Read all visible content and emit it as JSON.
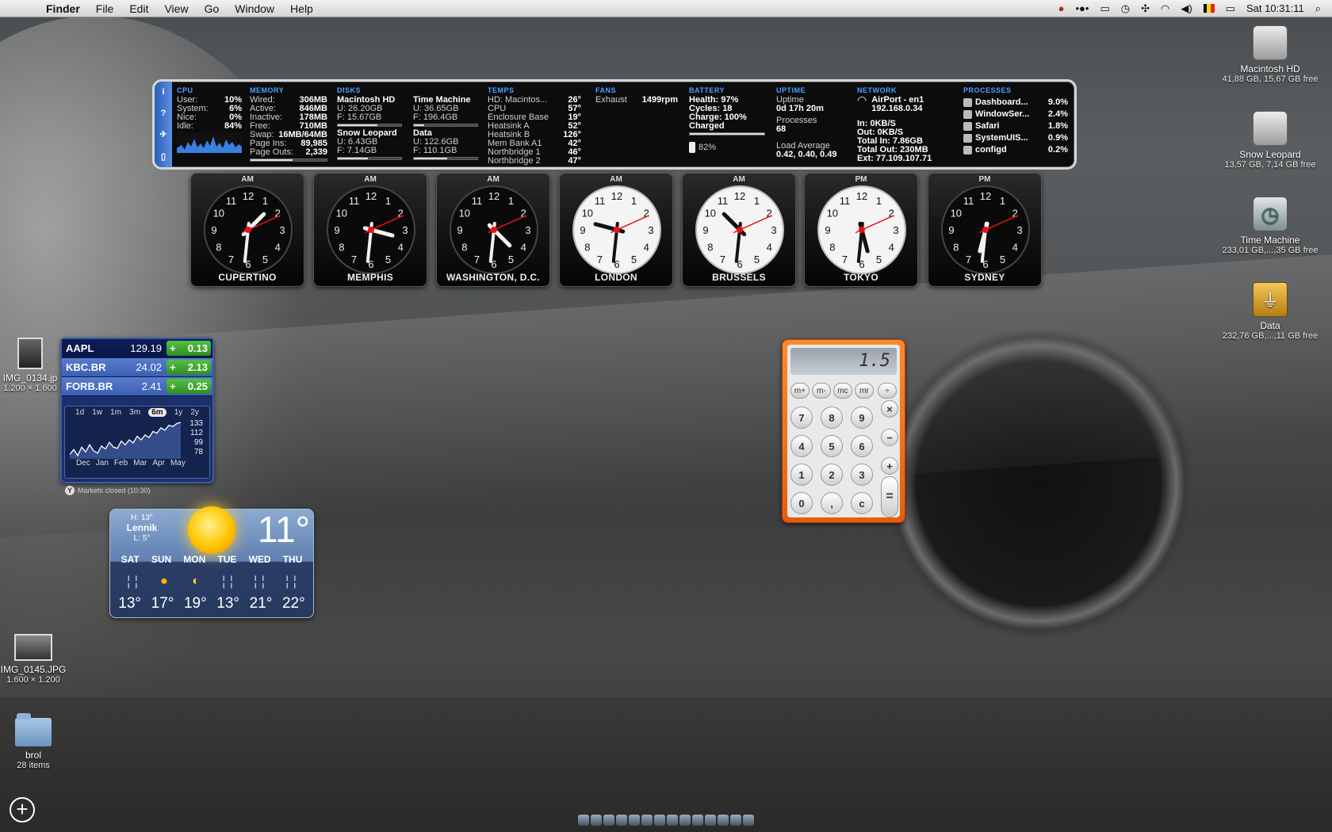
{
  "menubar": {
    "app": "Finder",
    "items": [
      "File",
      "Edit",
      "View",
      "Go",
      "Window",
      "Help"
    ],
    "clock": "Sat 10:31:11"
  },
  "desktop_icons": [
    {
      "name": "Macintosh HD",
      "sub": "41,88 GB, 15,67 GB free"
    },
    {
      "name": "Snow Leopard",
      "sub": "13,57 GB, 7,14 GB free"
    },
    {
      "name": "Time Machine",
      "sub": "233,01 GB,...,35 GB free"
    },
    {
      "name": "Data",
      "sub": "232,76 GB,...,11 GB free"
    }
  ],
  "left_icons": [
    {
      "name": "IMG_0134.jp",
      "sub": "1.200 × 1.600"
    },
    {
      "name": "IMG_0145.JPG",
      "sub": "1.600 × 1.200"
    },
    {
      "name": "brol",
      "sub": "28 items"
    }
  ],
  "istat": {
    "tabs": [
      "i",
      "?",
      "✈",
      "▯"
    ],
    "cpu": {
      "h": "CPU",
      "rows": [
        [
          "User:",
          "10%"
        ],
        [
          "System:",
          "6%"
        ],
        [
          "Nice:",
          "0%"
        ],
        [
          "Idle:",
          "84%"
        ]
      ]
    },
    "memory": {
      "h": "MEMORY",
      "rows": [
        [
          "Wired:",
          "306MB"
        ],
        [
          "Active:",
          "846MB"
        ],
        [
          "Inactive:",
          "178MB"
        ],
        [
          "Free:",
          "710MB"
        ],
        [
          "Swap:",
          "16MB/64MB"
        ],
        [
          "Page Ins:",
          "89,985"
        ],
        [
          "Page Outs:",
          "2,339"
        ]
      ],
      "usage": 0.55
    },
    "disks": {
      "h": "DISKS",
      "a": {
        "name": "Macintosh HD",
        "u": "U: 26.20GB",
        "f": "F: 15.67GB",
        "usage": 0.63
      },
      "b": {
        "name": "Snow Leopard",
        "u": "U: 6.43GB",
        "f": "F: 7.14GB",
        "usage": 0.47
      },
      "c": {
        "name": "Time Machine",
        "u": "U: 36.65GB",
        "f": "F: 196.4GB",
        "usage": 0.16
      },
      "d": {
        "name": "Data",
        "u": "U: 122.6GB",
        "f": "F: 110.1GB",
        "usage": 0.53
      }
    },
    "temps": {
      "h": "TEMPS",
      "rows": [
        [
          "HD: Macintos...",
          "26°"
        ],
        [
          "CPU",
          "57°"
        ],
        [
          "Enclosure Base",
          "19°"
        ],
        [
          "Heatsink A",
          "52°"
        ],
        [
          "Heatsink B",
          "126°"
        ],
        [
          "Mem Bank A1",
          "42°"
        ],
        [
          "Northbridge 1",
          "46°"
        ],
        [
          "Northbridge 2",
          "47°"
        ]
      ]
    },
    "fans": {
      "h": "FANS",
      "name": "Exhaust",
      "value": "1499rpm"
    },
    "battery": {
      "h": "BATTERY",
      "health": "Health: 97%",
      "cycles": "Cycles: 18",
      "charge": "Charge: 100%",
      "status": "Charged",
      "level": "82%"
    },
    "uptime": {
      "h": "UPTIME",
      "l1": "Uptime",
      "v1": "0d 17h 20m",
      "l2": "Processes",
      "v2": "68",
      "l3": "Load Average",
      "v3": "0.42, 0.40, 0.49"
    },
    "network": {
      "h": "NETWORK",
      "iface": "AirPort - en1",
      "ip": "192.168.0.34",
      "in": "In: 0KB/S",
      "out": "Out: 0KB/S",
      "tin": "Total In: 7.86GB",
      "tout": "Total Out: 230MB",
      "ext": "Ext: 77.109.107.71"
    },
    "processes": {
      "h": "PROCESSES",
      "rows": [
        [
          "Dashboard...",
          "9.0%"
        ],
        [
          "WindowSer...",
          "2.4%"
        ],
        [
          "Safari",
          "1.8%"
        ],
        [
          "SystemUIS...",
          "0.9%"
        ],
        [
          "configd",
          "0.2%"
        ]
      ]
    }
  },
  "clocks": [
    {
      "city": "CUPERTINO",
      "ampm": "AM",
      "face": "dark",
      "h": 1.5,
      "m": 31,
      "s": 11
    },
    {
      "city": "MEMPHIS",
      "ampm": "AM",
      "face": "dark",
      "h": 3.5,
      "m": 31,
      "s": 11
    },
    {
      "city": "WASHINGTON, D.C.",
      "ampm": "AM",
      "face": "dark",
      "h": 4.5,
      "m": 31,
      "s": 11
    },
    {
      "city": "LONDON",
      "ampm": "AM",
      "face": "light",
      "h": 9.5,
      "m": 31,
      "s": 11
    },
    {
      "city": "BRUSSELS",
      "ampm": "AM",
      "face": "light",
      "h": 10.5,
      "m": 31,
      "s": 11
    },
    {
      "city": "TOKYO",
      "ampm": "PM",
      "face": "light",
      "h": 5.5,
      "m": 31,
      "s": 11
    },
    {
      "city": "SYDNEY",
      "ampm": "PM",
      "face": "dark",
      "h": 6.5,
      "m": 31,
      "s": 11
    }
  ],
  "stocks": {
    "rows": [
      {
        "sym": "AAPL",
        "price": "129.19",
        "sign": "+",
        "chg": "0.13"
      },
      {
        "sym": "KBC.BR",
        "price": "24.02",
        "sign": "+",
        "chg": "2.13"
      },
      {
        "sym": "FORB.BR",
        "price": "2.41",
        "sign": "+",
        "chg": "0.25"
      }
    ],
    "ranges": [
      "1d",
      "1w",
      "1m",
      "3m",
      "6m",
      "1y",
      "2y"
    ],
    "selected_range": "6m",
    "months": [
      "Dec",
      "Jan",
      "Feb",
      "Mar",
      "Apr",
      "May"
    ],
    "yvals": [
      "133",
      "112",
      "99",
      "78"
    ],
    "footer": "Markets closed (10:30)",
    "series": [
      80,
      88,
      78,
      92,
      84,
      96,
      86,
      82,
      94,
      89,
      100,
      92,
      90,
      102,
      96,
      104,
      99,
      110,
      104,
      112,
      108,
      118,
      115,
      124,
      120,
      128,
      126,
      131,
      133
    ]
  },
  "weather": {
    "high": "H: 13°",
    "location": "Lennik",
    "low": "L: 5°",
    "temp": "11°",
    "days": [
      "SAT",
      "SUN",
      "MON",
      "TUE",
      "WED",
      "THU"
    ],
    "icons": [
      "rain",
      "sun",
      "partly",
      "rain",
      "rain",
      "rain"
    ],
    "temps": [
      "13°",
      "17°",
      "19°",
      "13°",
      "21°",
      "22°"
    ]
  },
  "calculator": {
    "display": "1.5",
    "memory": [
      "m+",
      "m-",
      "mc",
      "mr",
      "÷"
    ],
    "keys": [
      [
        "7",
        "8",
        "9",
        "×"
      ],
      [
        "4",
        "5",
        "6",
        "−"
      ],
      [
        "1",
        "2",
        "3",
        "+"
      ],
      [
        "0",
        ",",
        "c"
      ]
    ],
    "equals": "="
  }
}
